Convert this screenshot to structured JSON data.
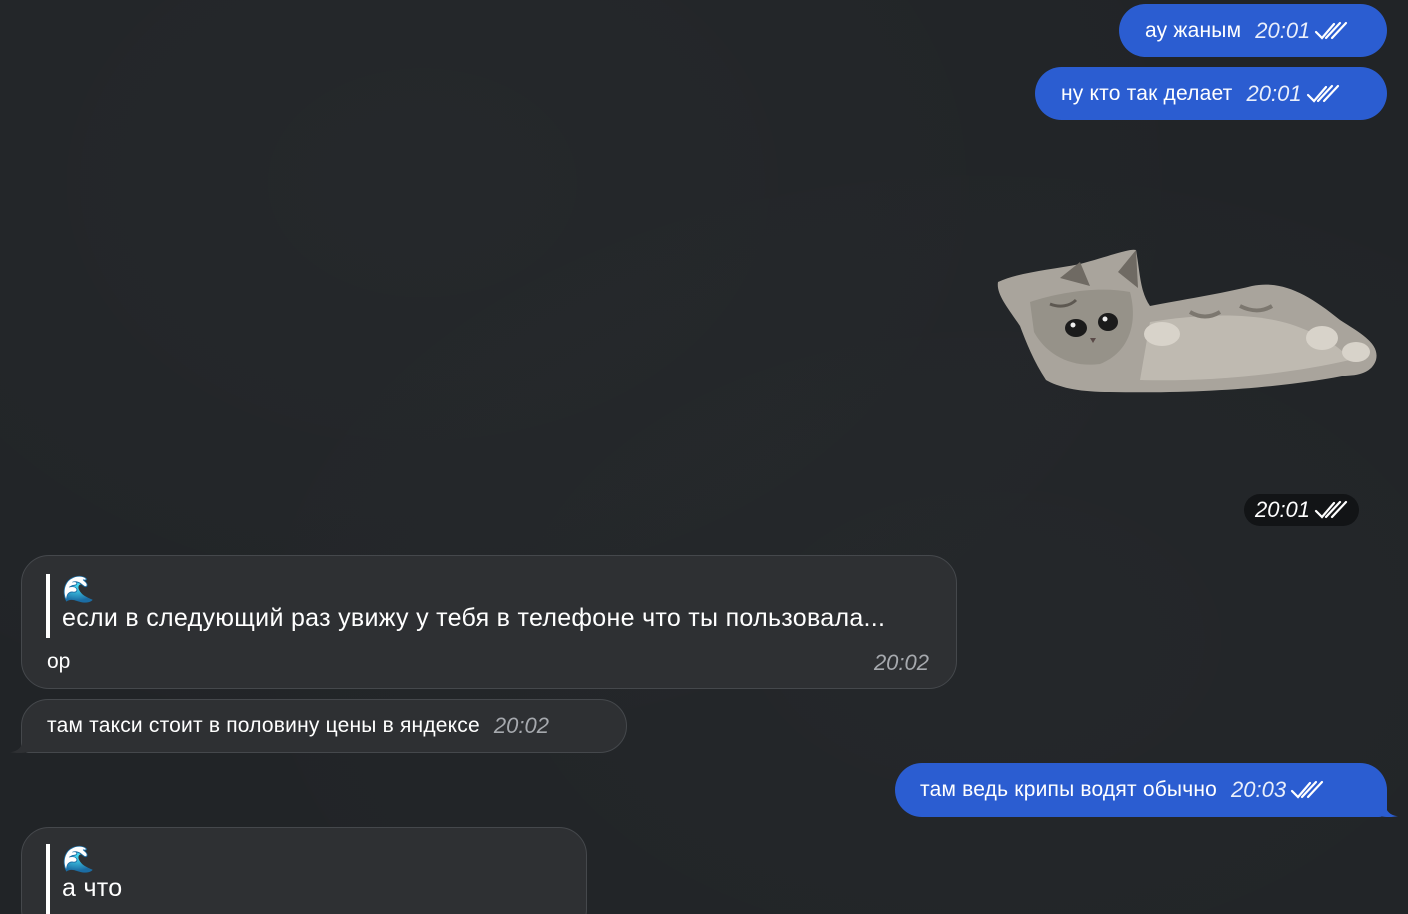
{
  "messages": {
    "m1": {
      "text": "ау жаным",
      "time": "20:01"
    },
    "m2": {
      "text": "ну кто так делает",
      "time": "20:01"
    },
    "sticker": {
      "icon": "kitten-sticker",
      "time": "20:01"
    },
    "m3": {
      "reply_icon": "🌊",
      "reply_text": "если в следующий раз увижу у тебя в телефоне что ты пользовала...",
      "text": "ор",
      "time": "20:02"
    },
    "m4": {
      "text": "там такси стоит в половину цены в яндексе",
      "time": "20:02"
    },
    "m5": {
      "text": "там ведь крипы водят обычно",
      "time": "20:03"
    },
    "m6": {
      "reply_icon": "🌊",
      "reply_text": "а что"
    }
  },
  "colors": {
    "background": "#212427",
    "outgoing_bubble": "#2b5dd1",
    "incoming_bubble": "#2e3033"
  }
}
